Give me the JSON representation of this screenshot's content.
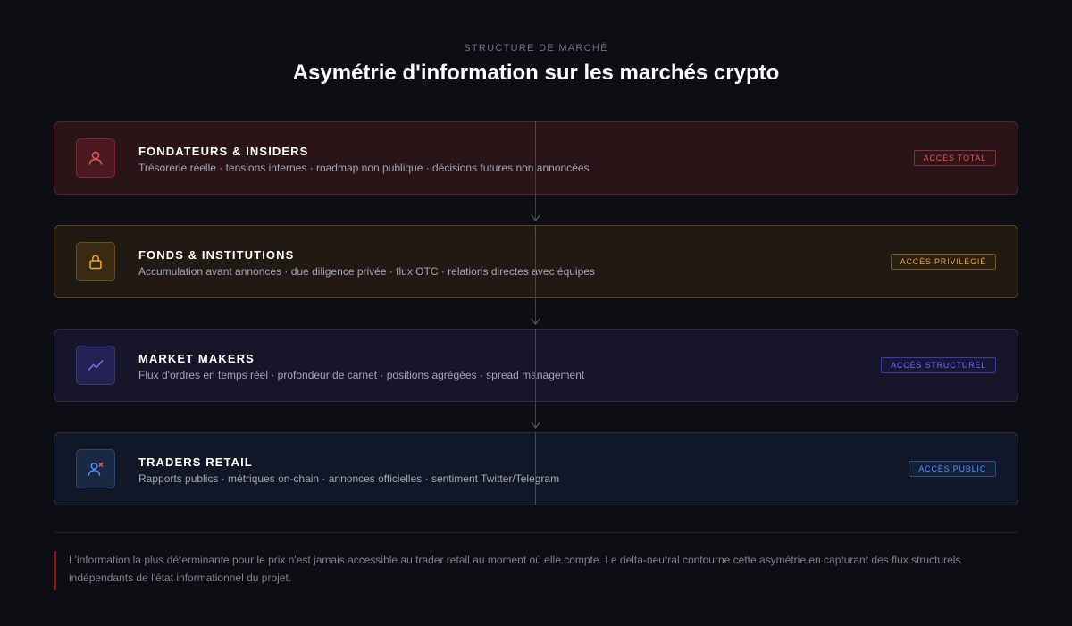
{
  "header": {
    "eyebrow": "STRUCTURE DE MARCHÉ",
    "title": "Asymétrie d'information sur les marchés crypto"
  },
  "tiers": [
    {
      "name": "FONDATEURS & INSIDERS",
      "description": "Trésorerie réelle · tensions internes · roadmap non publique · décisions futures non annoncées",
      "badge": "ACCÈS TOTAL",
      "icon": "user-icon",
      "color": "#e8545c"
    },
    {
      "name": "FONDS & INSTITUTIONS",
      "description": "Accumulation avant annonces · due diligence privée · flux OTC · relations directes avec équipes",
      "badge": "ACCÈS PRIVILÉGIÉ",
      "icon": "lock-icon",
      "color": "#f0a43a"
    },
    {
      "name": "MARKET MAKERS",
      "description": "Flux d'ordres en temps réel · profondeur de carnet · positions agrégées · spread management",
      "badge": "ACCÈS STRUCTUREL",
      "icon": "trend-line-icon",
      "color": "#6f6cf0"
    },
    {
      "name": "TRADERS RETAIL",
      "description": "Rapports publics · métriques on-chain · annonces officielles · sentiment Twitter/Telegram",
      "badge": "ACCÈS PUBLIC",
      "icon": "user-x-icon",
      "color": "#5a8ff0"
    }
  ],
  "footer": {
    "note": "L'information la plus déterminante pour le prix n'est jamais accessible au trader retail au moment où elle compte. Le delta-neutral contourne cette asymétrie en capturant des flux structurels indépendants de l'état informationnel du projet."
  }
}
